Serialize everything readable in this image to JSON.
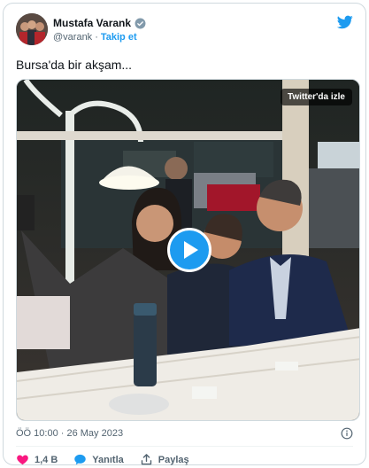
{
  "author": {
    "display_name": "Mustafa Varank",
    "handle": "@varank",
    "separator": "·",
    "follow_label": "Takip et"
  },
  "tweet": {
    "text": "Bursa'da bir akşam..."
  },
  "media": {
    "badge": "Twitter'da izle"
  },
  "meta": {
    "timestamp": "ÖÖ 10:00 · 26 May 2023"
  },
  "actions": {
    "like_count": "1,4 B",
    "reply_label": "Yanıtla",
    "share_label": "Paylaş"
  },
  "colors": {
    "accent": "#1d9bf0",
    "like": "#f91880",
    "text": "#0f1419",
    "muted": "#536471"
  }
}
